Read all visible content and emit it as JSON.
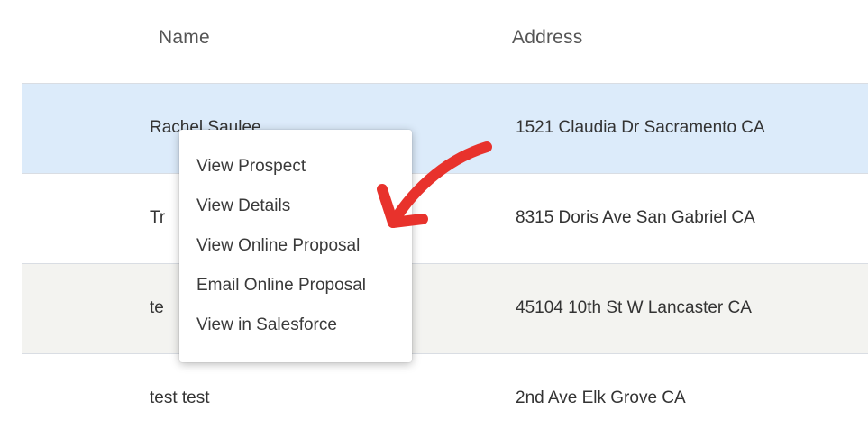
{
  "table": {
    "columns": {
      "name": "Name",
      "address": "Address"
    },
    "rows": [
      {
        "name": "Rachel Saulee",
        "address": "1521 Claudia Dr Sacramento CA",
        "selected": true
      },
      {
        "name": "Tr",
        "address": "8315 Doris Ave San Gabriel CA",
        "selected": false
      },
      {
        "name": "te",
        "address": "45104 10th St W Lancaster CA",
        "selected": false
      },
      {
        "name": "test test",
        "address": "2nd Ave Elk Grove CA",
        "selected": false
      }
    ]
  },
  "context_menu": {
    "items": [
      {
        "label": "View Prospect"
      },
      {
        "label": "View Details"
      },
      {
        "label": "View Online Proposal"
      },
      {
        "label": "Email Online Proposal"
      },
      {
        "label": "View in Salesforce"
      }
    ]
  },
  "colors": {
    "selected_row": "#dcebfa",
    "zebra_row": "#f3f3f0",
    "annotation_arrow": "#e8322c",
    "divider": "#d9dde3"
  },
  "icons": {
    "annotation": "red-arrow-icon"
  }
}
